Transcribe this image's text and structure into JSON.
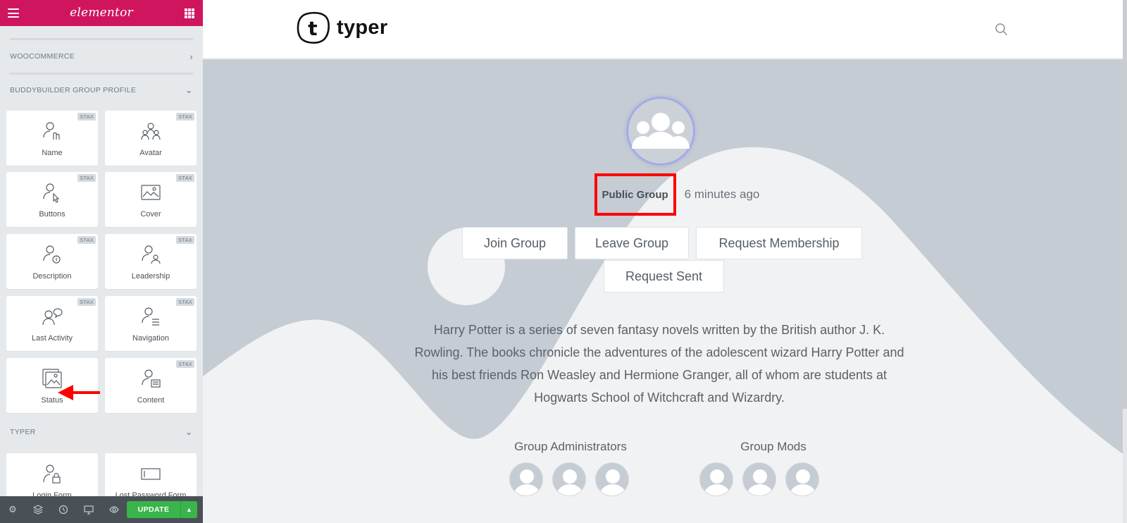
{
  "panel": {
    "logo": "elementor",
    "categories": {
      "woocommerce": "WOOCOMMERCE",
      "group_profile": "BUDDYBUILDER GROUP PROFILE",
      "typer": "TYPER"
    },
    "badge": "STAX",
    "widgets": {
      "name": "Name",
      "avatar": "Avatar",
      "buttons": "Buttons",
      "cover": "Cover",
      "description": "Description",
      "leadership": "Leadership",
      "last_activity": "Last Activity",
      "navigation": "Navigation",
      "status": "Status",
      "content": "Content",
      "login_form": "Login Form",
      "lost_password_form": "Lost Password Form"
    },
    "footer": {
      "update_label": "UPDATE"
    }
  },
  "site": {
    "brand": "typer",
    "logo_letter": "t"
  },
  "group": {
    "status": "Public Group",
    "time_ago": "6 minutes ago",
    "buttons": {
      "join": "Join Group",
      "leave": "Leave Group",
      "request_membership": "Request Membership",
      "request_sent": "Request Sent"
    },
    "description": "Harry Potter is a series of seven fantasy novels written by the British author J. K. Rowling. The books chronicle the adventures of the adolescent wizard Harry Potter and his best friends Ron Weasley and Hermione Granger, all of whom are students at Hogwarts School of Witchcraft and Wizardry.",
    "administrators_title": "Group Administrators",
    "mods_title": "Group Mods"
  },
  "colors": {
    "elementor_pink": "#d0155f",
    "update_green": "#39b54a",
    "annotation_red": "#ff0000",
    "hero_gray": "#c5ccd3"
  }
}
